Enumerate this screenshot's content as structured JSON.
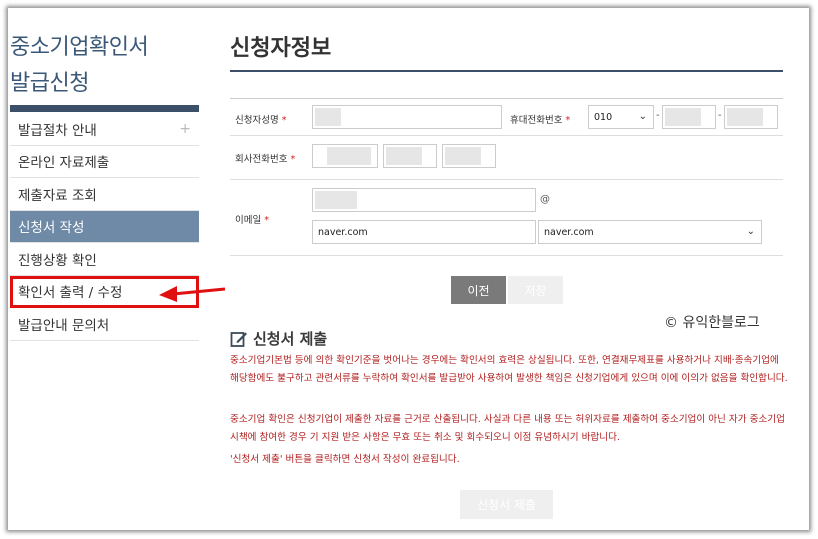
{
  "sidebar": {
    "title_line1": "중소기업확인서",
    "title_line2": "발급신청",
    "items": [
      {
        "label": "발급절차 안내",
        "plus": "+"
      },
      {
        "label": "온라인 자료제출"
      },
      {
        "label": "제출자료 조회"
      },
      {
        "label": "신청서 작성"
      },
      {
        "label": "진행상황 확인"
      },
      {
        "label": "확인서 출력 / 수정"
      },
      {
        "label": "발급안내 문의처"
      }
    ]
  },
  "main": {
    "title": "신청자정보",
    "form": {
      "applicant_name_label": "신청자성명",
      "mobile_label": "휴대전화번호",
      "mobile_prefix": "010",
      "company_phone_label": "회사전화번호",
      "email_label": "이메일",
      "required_mark": "*",
      "email_at": "@",
      "email_domain_value": "naver.com",
      "email_domain_select": "naver.com",
      "dash": "-"
    },
    "buttons": {
      "prev": "이전",
      "save": "저장",
      "submit": "신청서 제출"
    },
    "submit_section": {
      "heading": "신청서 제출",
      "notice1": "중소기업기본법 등에 의한 확인기준을 벗어나는 경우에는 확인서의 효력은 상실됩니다. 또한, 연결재무제표를 사용하거나 지배·종속기업에 해당함에도 불구하고 관련서류를 누락하여 확인서를 발급받아 사용하여 발생한 책임은 신청기업에게 있으며 이에 이의가 없음을 확인합니다.",
      "notice2": "중소기업 확인은 신청기업이 제출한 자료를 근거로 산출됩니다. 사실과 다른 내용 또는 허위자료를 제출하여 중소기업이 아닌 자가 중소기업 시책에 참여한 경우 기 지원 받은 사항은 무효 또는 취소 및 회수되오니 이점 유념하시기 바랍니다.",
      "notice3": "'신청서 제출' 버튼을 클릭하면 신청서 작성이 완료됩니다."
    }
  },
  "watermark": "© 유익한블로그",
  "colors": {
    "sidebar_active": "#6e8aa6",
    "title_blue": "#3b5878",
    "highlight_red": "#e01010",
    "notice_red": "#b01e1e"
  }
}
